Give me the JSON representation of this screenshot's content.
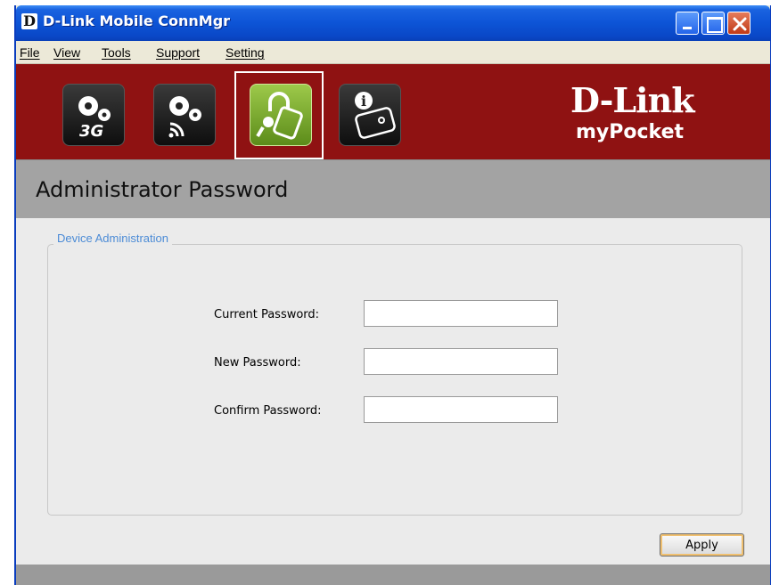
{
  "window": {
    "title": "D-Link Mobile ConnMgr",
    "app_icon_letter": "D"
  },
  "menu": [
    {
      "key": "F",
      "rest": "ile"
    },
    {
      "key": "V",
      "rest": "iew"
    },
    {
      "key": "T",
      "rest": "ools"
    },
    {
      "key": "S",
      "rest": "upport"
    },
    {
      "key": "S",
      "rest": "etting"
    }
  ],
  "toolbar": {
    "tools": [
      {
        "icon": "gears-3g-icon",
        "badge": "3G"
      },
      {
        "icon": "gears-wireless-icon"
      },
      {
        "icon": "key-lock-icon",
        "selected": true
      },
      {
        "icon": "device-info-icon"
      }
    ]
  },
  "brand": {
    "name": "D-Link",
    "product": "myPocket"
  },
  "page": {
    "title": "Administrator Password"
  },
  "form": {
    "legend": "Device Administration",
    "fields": [
      {
        "label": "Current Password:",
        "value": ""
      },
      {
        "label": "New Password:",
        "value": ""
      },
      {
        "label": "Confirm Password:",
        "value": ""
      }
    ],
    "apply_label": "Apply"
  },
  "colors": {
    "title_bar": "#0d54d6",
    "banner": "#8f1212",
    "section": "#a3a3a3",
    "legend": "#4b8bd6",
    "selected_tool": "#7fb236"
  }
}
